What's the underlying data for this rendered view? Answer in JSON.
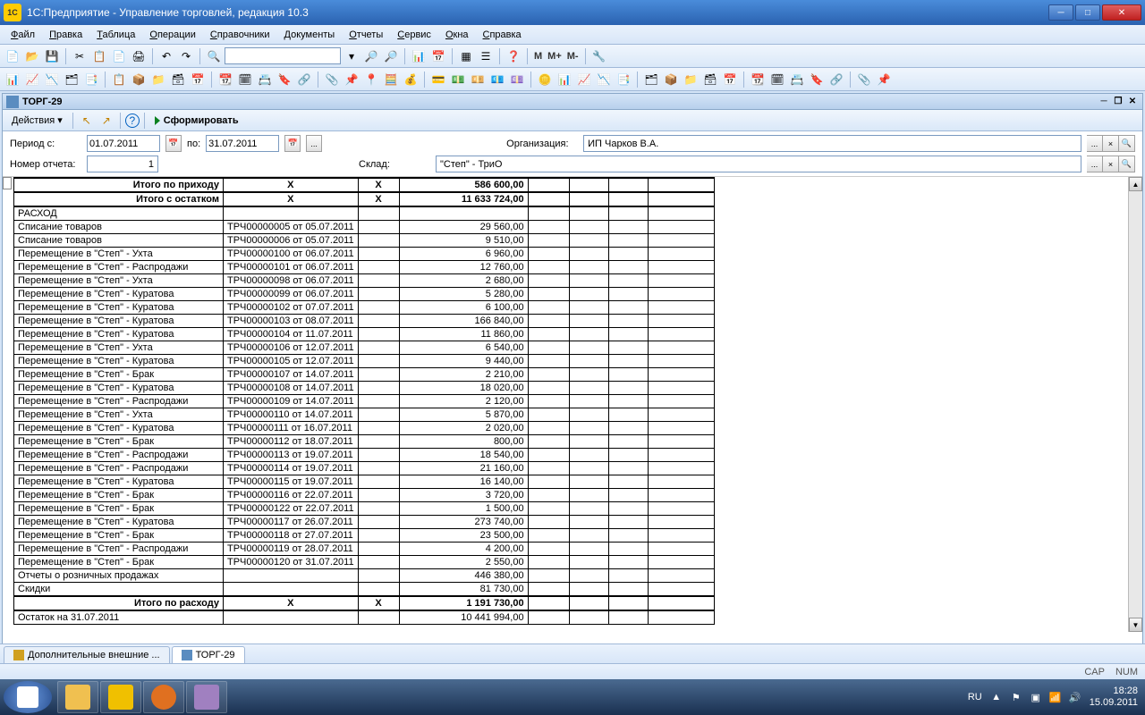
{
  "window": {
    "title": "1С:Предприятие - Управление торговлей, редакция 10.3"
  },
  "menu": [
    "Файл",
    "Правка",
    "Таблица",
    "Операции",
    "Справочники",
    "Документы",
    "Отчеты",
    "Сервис",
    "Окна",
    "Справка"
  ],
  "doc": {
    "title": "ТОРГ-29",
    "actions_label": "Действия",
    "form_label": "Сформировать"
  },
  "filters": {
    "period_label": "Период с:",
    "date_from": "01.07.2011",
    "to_label": "по:",
    "date_to": "31.07.2011",
    "ellipsis": "...",
    "report_num_label": "Номер отчета:",
    "report_num": "1",
    "org_label": "Организация:",
    "org_value": "ИП Чарков В.А.",
    "warehouse_label": "Склад:",
    "warehouse_value": "\"Степ\" - ТриО"
  },
  "summary": {
    "income_total_label": "Итого по приходу",
    "income_total": "586 600,00",
    "with_balance_label": "Итого с остатком",
    "with_balance": "11 633 724,00",
    "x": "X",
    "expense_header": "РАСХОД",
    "expense_total_label": "Итого по расходу",
    "expense_total": "1 191 730,00",
    "balance_label": "Остаток на 31.07.2011",
    "balance": "10 441 994,00"
  },
  "rows": [
    {
      "op": "Списание товаров",
      "doc": "ТРЧ00000005 от 05.07.2011",
      "sum": "29 560,00"
    },
    {
      "op": "Списание товаров",
      "doc": "ТРЧ00000006 от 05.07.2011",
      "sum": "9 510,00"
    },
    {
      "op": "Перемещение в \"Степ\" - Ухта",
      "doc": "ТРЧ00000100 от 06.07.2011",
      "sum": "6 960,00"
    },
    {
      "op": "Перемещение в \"Степ\" - Распродажи",
      "doc": "ТРЧ00000101 от 06.07.2011",
      "sum": "12 760,00"
    },
    {
      "op": "Перемещение в \"Степ\" - Ухта",
      "doc": "ТРЧ00000098 от 06.07.2011",
      "sum": "2 680,00"
    },
    {
      "op": "Перемещение в \"Степ\" - Куратова",
      "doc": "ТРЧ00000099 от 06.07.2011",
      "sum": "5 280,00"
    },
    {
      "op": "Перемещение в \"Степ\" - Куратова",
      "doc": "ТРЧ00000102 от 07.07.2011",
      "sum": "6 100,00"
    },
    {
      "op": "Перемещение в \"Степ\" - Куратова",
      "doc": "ТРЧ00000103 от 08.07.2011",
      "sum": "166 840,00"
    },
    {
      "op": "Перемещение в \"Степ\" - Куратова",
      "doc": "ТРЧ00000104 от 11.07.2011",
      "sum": "11 860,00"
    },
    {
      "op": "Перемещение в \"Степ\" - Ухта",
      "doc": "ТРЧ00000106 от 12.07.2011",
      "sum": "6 540,00"
    },
    {
      "op": "Перемещение в \"Степ\" - Куратова",
      "doc": "ТРЧ00000105 от 12.07.2011",
      "sum": "9 440,00"
    },
    {
      "op": "Перемещение в \"Степ\" - Брак",
      "doc": "ТРЧ00000107 от 14.07.2011",
      "sum": "2 210,00"
    },
    {
      "op": "Перемещение в \"Степ\" - Куратова",
      "doc": "ТРЧ00000108 от 14.07.2011",
      "sum": "18 020,00"
    },
    {
      "op": "Перемещение в \"Степ\" - Распродажи",
      "doc": "ТРЧ00000109 от 14.07.2011",
      "sum": "2 120,00"
    },
    {
      "op": "Перемещение в \"Степ\" - Ухта",
      "doc": "ТРЧ00000110 от 14.07.2011",
      "sum": "5 870,00"
    },
    {
      "op": "Перемещение в \"Степ\" - Куратова",
      "doc": "ТРЧ00000111 от 16.07.2011",
      "sum": "2 020,00"
    },
    {
      "op": "Перемещение в \"Степ\" - Брак",
      "doc": "ТРЧ00000112 от 18.07.2011",
      "sum": "800,00"
    },
    {
      "op": "Перемещение в \"Степ\" - Распродажи",
      "doc": "ТРЧ00000113 от 19.07.2011",
      "sum": "18 540,00"
    },
    {
      "op": "Перемещение в \"Степ\" - Распродажи",
      "doc": "ТРЧ00000114 от 19.07.2011",
      "sum": "21 160,00"
    },
    {
      "op": "Перемещение в \"Степ\" - Куратова",
      "doc": "ТРЧ00000115 от 19.07.2011",
      "sum": "16 140,00"
    },
    {
      "op": "Перемещение в \"Степ\" - Брак",
      "doc": "ТРЧ00000116 от 22.07.2011",
      "sum": "3 720,00"
    },
    {
      "op": "Перемещение в \"Степ\" - Брак",
      "doc": "ТРЧ00000122 от 22.07.2011",
      "sum": "1 500,00"
    },
    {
      "op": "Перемещение в \"Степ\" - Куратова",
      "doc": "ТРЧ00000117 от 26.07.2011",
      "sum": "273 740,00"
    },
    {
      "op": "Перемещение в \"Степ\" - Брак",
      "doc": "ТРЧ00000118 от 27.07.2011",
      "sum": "23 500,00"
    },
    {
      "op": "Перемещение в \"Степ\" - Распродажи",
      "doc": "ТРЧ00000119 от 28.07.2011",
      "sum": "4 200,00"
    },
    {
      "op": "Перемещение в \"Степ\" - Брак",
      "doc": "ТРЧ00000120 от 31.07.2011",
      "sum": "2 550,00"
    },
    {
      "op": "Отчеты о розничных продажах",
      "doc": "",
      "sum": "446 380,00"
    },
    {
      "op": "Скидки",
      "doc": "",
      "sum": "81 730,00"
    }
  ],
  "tabs": {
    "t1": "Дополнительные внешние ...",
    "t2": "ТОРГ-29"
  },
  "status": {
    "cap": "CAP",
    "num": "NUM"
  },
  "tray": {
    "lang": "RU",
    "time": "18:28",
    "date": "15.09.2011"
  }
}
